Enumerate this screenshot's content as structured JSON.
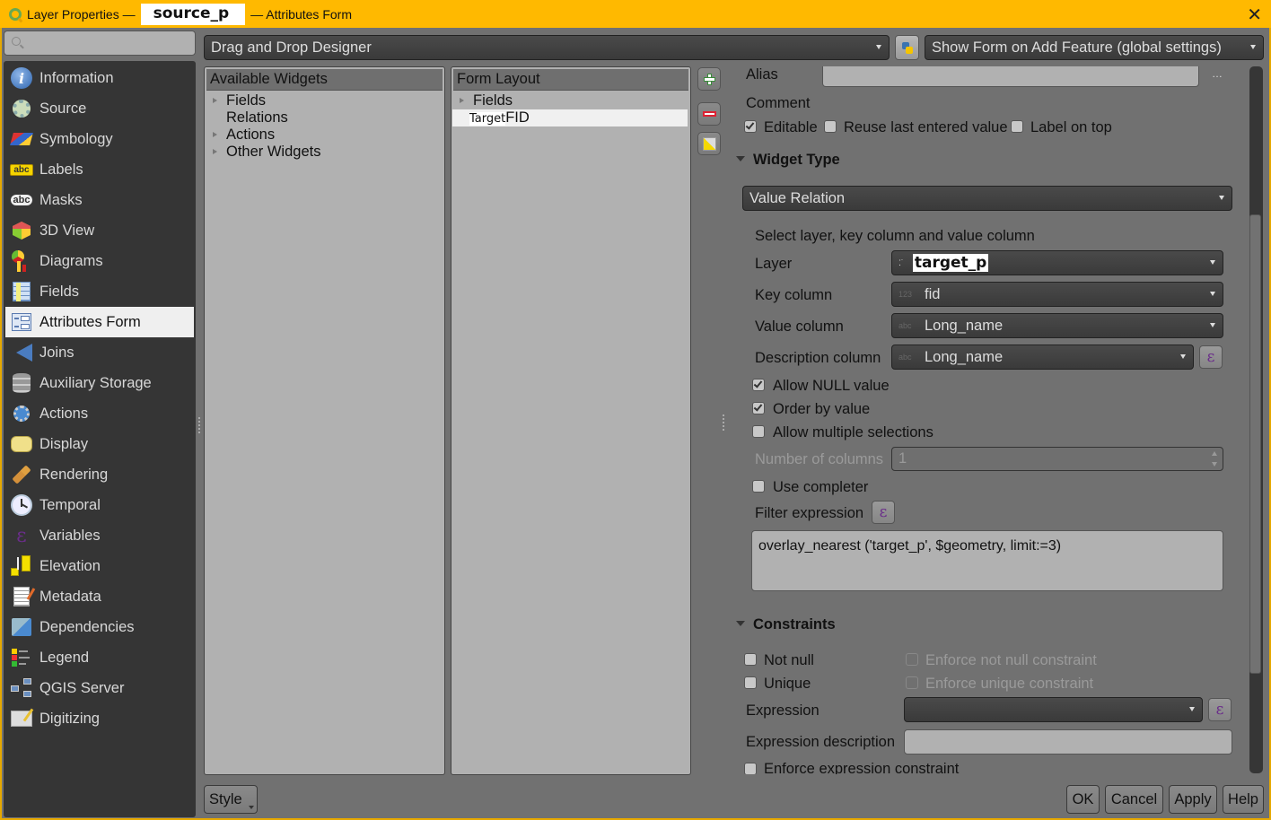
{
  "window": {
    "title_prefix": "Layer Properties —",
    "layer_name": "source_p",
    "title_suffix": "— Attributes Form",
    "close_icon": "close-icon"
  },
  "search": {
    "placeholder": "",
    "icon": "search-icon"
  },
  "sidebar": {
    "selected": "Attributes Form",
    "items": [
      {
        "label": "Information",
        "icon": "information-icon"
      },
      {
        "label": "Source",
        "icon": "source-wrench-icon"
      },
      {
        "label": "Symbology",
        "icon": "symbology-brush-icon"
      },
      {
        "label": "Labels",
        "icon": "labels-abc-icon"
      },
      {
        "label": "Masks",
        "icon": "masks-abc-icon"
      },
      {
        "label": "3D View",
        "icon": "3d-cube-icon"
      },
      {
        "label": "Diagrams",
        "icon": "diagrams-icon"
      },
      {
        "label": "Fields",
        "icon": "fields-table-icon"
      },
      {
        "label": "Attributes Form",
        "icon": "attributes-form-icon"
      },
      {
        "label": "Joins",
        "icon": "joins-icon"
      },
      {
        "label": "Auxiliary Storage",
        "icon": "auxiliary-storage-icon"
      },
      {
        "label": "Actions",
        "icon": "actions-gear-icon"
      },
      {
        "label": "Display",
        "icon": "display-bubble-icon"
      },
      {
        "label": "Rendering",
        "icon": "rendering-brush-icon"
      },
      {
        "label": "Temporal",
        "icon": "temporal-clock-icon"
      },
      {
        "label": "Variables",
        "icon": "variables-epsilon-icon"
      },
      {
        "label": "Elevation",
        "icon": "elevation-icon"
      },
      {
        "label": "Metadata",
        "icon": "metadata-icon"
      },
      {
        "label": "Dependencies",
        "icon": "dependencies-icon"
      },
      {
        "label": "Legend",
        "icon": "legend-icon"
      },
      {
        "label": "QGIS Server",
        "icon": "qgis-server-icon"
      },
      {
        "label": "Digitizing",
        "icon": "digitizing-icon"
      }
    ]
  },
  "toolbar": {
    "designer_mode": "Drag and Drop Designer",
    "python_icon": "python-icon",
    "show_form_mode": "Show Form on Add Feature (global settings)"
  },
  "available_widgets": {
    "header": "Available Widgets",
    "items": [
      {
        "label": "Fields",
        "expandable": true
      },
      {
        "label": "Relations",
        "expandable": false
      },
      {
        "label": "Actions",
        "expandable": true
      },
      {
        "label": "Other Widgets",
        "expandable": true
      }
    ]
  },
  "form_layout": {
    "header": "Form Layout",
    "items": [
      {
        "label": "Fields",
        "expandable": true
      },
      {
        "label_prefix": "Target",
        "label": "FID",
        "selected": true
      }
    ],
    "buttons": {
      "add": "add-icon",
      "remove": "remove-icon",
      "edit": "edit-icon"
    }
  },
  "general": {
    "alias_label": "Alias",
    "alias_value": "",
    "alias_menu": "…",
    "comment_label": "Comment",
    "editable": {
      "label": "Editable",
      "checked": true
    },
    "reuse_last": {
      "label": "Reuse last entered value",
      "checked": false
    },
    "label_on_top": {
      "label": "Label on top",
      "checked": false
    }
  },
  "widget_type": {
    "header": "Widget Type",
    "value": "Value Relation",
    "description": "Select layer, key column and value column",
    "layer": {
      "label": "Layer",
      "value": "target_p"
    },
    "key_column": {
      "label": "Key column",
      "type_tag": "123",
      "value": "fid"
    },
    "value_column": {
      "label": "Value column",
      "type_tag": "abc",
      "value": "Long_name"
    },
    "description_column": {
      "label": "Description column",
      "type_tag": "abc",
      "value": "Long_name"
    },
    "allow_null": {
      "label": "Allow NULL value",
      "checked": true
    },
    "order_by_value": {
      "label": "Order by value",
      "checked": true
    },
    "allow_multiple": {
      "label": "Allow multiple selections",
      "checked": false
    },
    "num_columns": {
      "label": "Number of columns",
      "value": "1",
      "enabled": false
    },
    "use_completer": {
      "label": "Use completer",
      "checked": false
    },
    "filter_label": "Filter expression",
    "filter_value": "overlay_nearest ('target_p', $geometry, limit:=3)"
  },
  "constraints": {
    "header": "Constraints",
    "not_null": {
      "label": "Not null",
      "checked": false
    },
    "enforce_not_null": {
      "label": "Enforce not null constraint",
      "checked": false,
      "enabled": false
    },
    "unique": {
      "label": "Unique",
      "checked": false
    },
    "enforce_unique": {
      "label": "Enforce unique constraint",
      "checked": false,
      "enabled": false
    },
    "expression_label": "Expression",
    "expression_value": "",
    "expression_desc_label": "Expression description",
    "expression_desc_value": "",
    "enforce_expression": {
      "label": "Enforce expression constraint",
      "checked": false
    }
  },
  "scroll": {
    "position_fraction": 0.21,
    "visible_fraction": 0.65
  },
  "footer": {
    "style": "Style",
    "ok": "OK",
    "cancel": "Cancel",
    "apply": "Apply",
    "help": "Help"
  }
}
